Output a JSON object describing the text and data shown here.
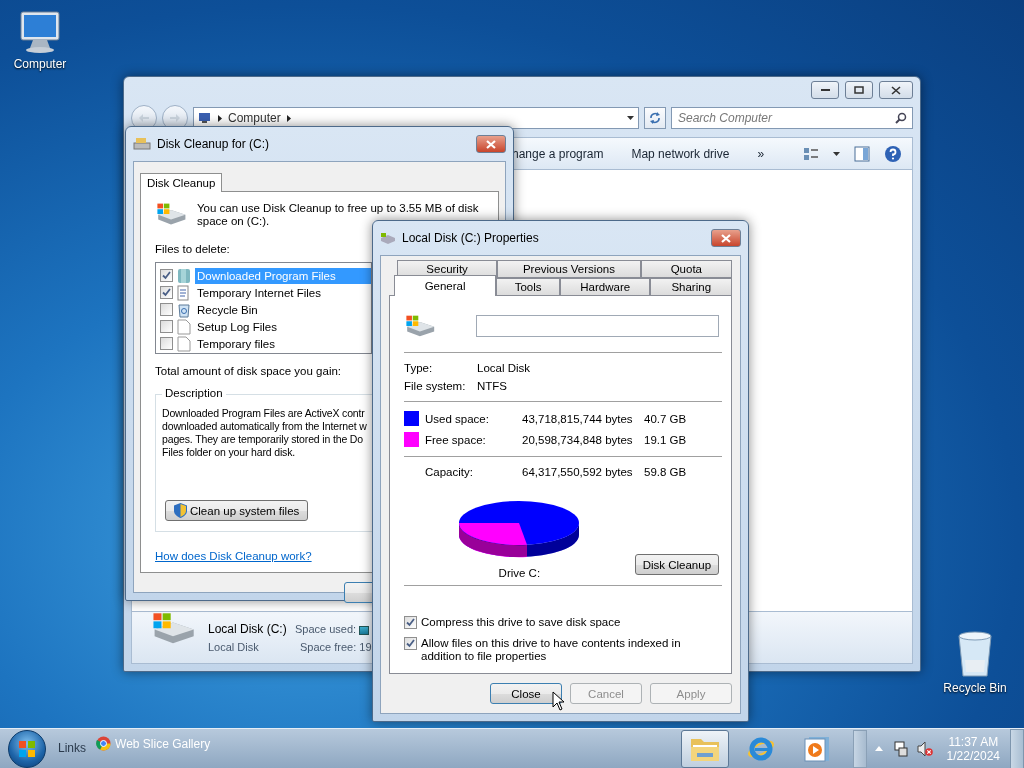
{
  "desktop_icons": [
    {
      "kind": "computer",
      "label": "Computer"
    },
    {
      "kind": "recycle_bin",
      "label": "Recycle Bin"
    }
  ],
  "explorer": {
    "address": [
      "Computer"
    ],
    "search": {
      "placeholder": "Search Computer"
    },
    "toolbar": [
      "hange a program",
      "Map network drive",
      "»"
    ],
    "details": {
      "name": "Local Disk (C:)",
      "type": "Local Disk",
      "used_label": "Space used:",
      "free_label": "Space free: 19"
    }
  },
  "disk_cleanup": {
    "title": "Disk Cleanup for  (C:)",
    "tab": "Disk Cleanup",
    "intro": "You can use Disk Cleanup to free up to 3.55 MB of disk space on  (C:).",
    "files_label": "Files to delete:",
    "files": [
      {
        "kind": "program",
        "name": "Downloaded Program Files",
        "checked": true,
        "selected": true
      },
      {
        "kind": "internet",
        "name": "Temporary Internet Files",
        "checked": true,
        "selected": false
      },
      {
        "kind": "recycle",
        "name": "Recycle Bin",
        "checked": false,
        "selected": false
      },
      {
        "kind": "document",
        "name": "Setup Log Files",
        "checked": false,
        "selected": false
      },
      {
        "kind": "document",
        "name": "Temporary files",
        "checked": false,
        "selected": false
      }
    ],
    "total_label": "Total amount of disk space you gain:",
    "description_title": "Description",
    "description_lines": [
      "Downloaded Program Files are ActiveX contr",
      "downloaded automatically from the Internet w",
      "pages. They are temporarily stored in the Do",
      "Files folder on your hard disk."
    ],
    "system_button": "Clean up system files",
    "help_link": "How does Disk Cleanup work?"
  },
  "properties": {
    "title": "Local Disk (C:) Properties",
    "tab_rows": [
      [
        {
          "label": "Security",
          "selected": false
        },
        {
          "label": "Previous Versions",
          "selected": false
        },
        {
          "label": "Quota",
          "selected": false
        }
      ],
      [
        {
          "label": "General",
          "selected": true
        },
        {
          "label": "Tools",
          "selected": false
        },
        {
          "label": "Hardware",
          "selected": false
        },
        {
          "label": "Sharing",
          "selected": false
        }
      ]
    ],
    "info": [
      {
        "label": "Type:",
        "value": "Local Disk"
      },
      {
        "label": "File system:",
        "value": "NTFS"
      }
    ],
    "space": [
      {
        "label": "Used space:",
        "bytes": "43,718,815,744 bytes",
        "size": "40.7 GB",
        "color": "#0000ff"
      },
      {
        "label": "Free space:",
        "bytes": "20,598,734,848 bytes",
        "size": "19.1 GB",
        "color": "#ff00ff"
      }
    ],
    "capacity": {
      "label": "Capacity:",
      "bytes": "64,317,550,592 bytes",
      "size": "59.8 GB"
    },
    "drive_label": "Drive C:",
    "cleanup_button": "Disk Cleanup",
    "options": [
      {
        "label": "Compress this drive to save disk space",
        "checked": true
      },
      {
        "label": "Allow files on this drive to have contents indexed in addition to file properties",
        "checked": true
      }
    ],
    "buttons": [
      {
        "label": "Close",
        "disabled": false,
        "default": true
      },
      {
        "label": "Cancel",
        "disabled": true,
        "default": false
      },
      {
        "label": "Apply",
        "disabled": true,
        "default": false
      }
    ]
  },
  "taskbar": {
    "links_label": "Links",
    "link": "Web Slice Gallery",
    "apps": [
      {
        "kind": "folder",
        "active": true
      },
      {
        "kind": "browser",
        "active": false
      },
      {
        "kind": "media",
        "active": false
      }
    ],
    "volume_muted": true,
    "time": "11:37 AM",
    "date": "1/22/2024"
  }
}
